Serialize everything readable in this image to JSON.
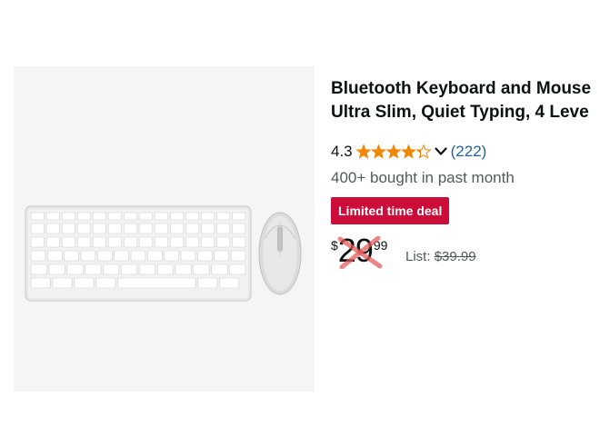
{
  "product": {
    "title_line1": "Bluetooth Keyboard and Mouse",
    "title_line2": "Ultra Slim, Quiet Typing, 4 Leve",
    "rating": "4.3",
    "rating_fraction": 0.86,
    "review_count": "(222)",
    "bought_text": "400+ bought in past month",
    "deal_label": "Limited time deal",
    "price_symbol": "$",
    "price_whole": "29",
    "price_fraction": "99",
    "list_label": "List:",
    "list_price": "$39.99"
  },
  "icons": {
    "stars": "star-rating-icon",
    "chevron": "chevron-down-icon",
    "price_mark": "red-x-mark-icon"
  },
  "colors": {
    "star": "#f08804",
    "link": "#2162a1",
    "deal": "#cc0c39",
    "x_mark": "#e55c5c"
  }
}
